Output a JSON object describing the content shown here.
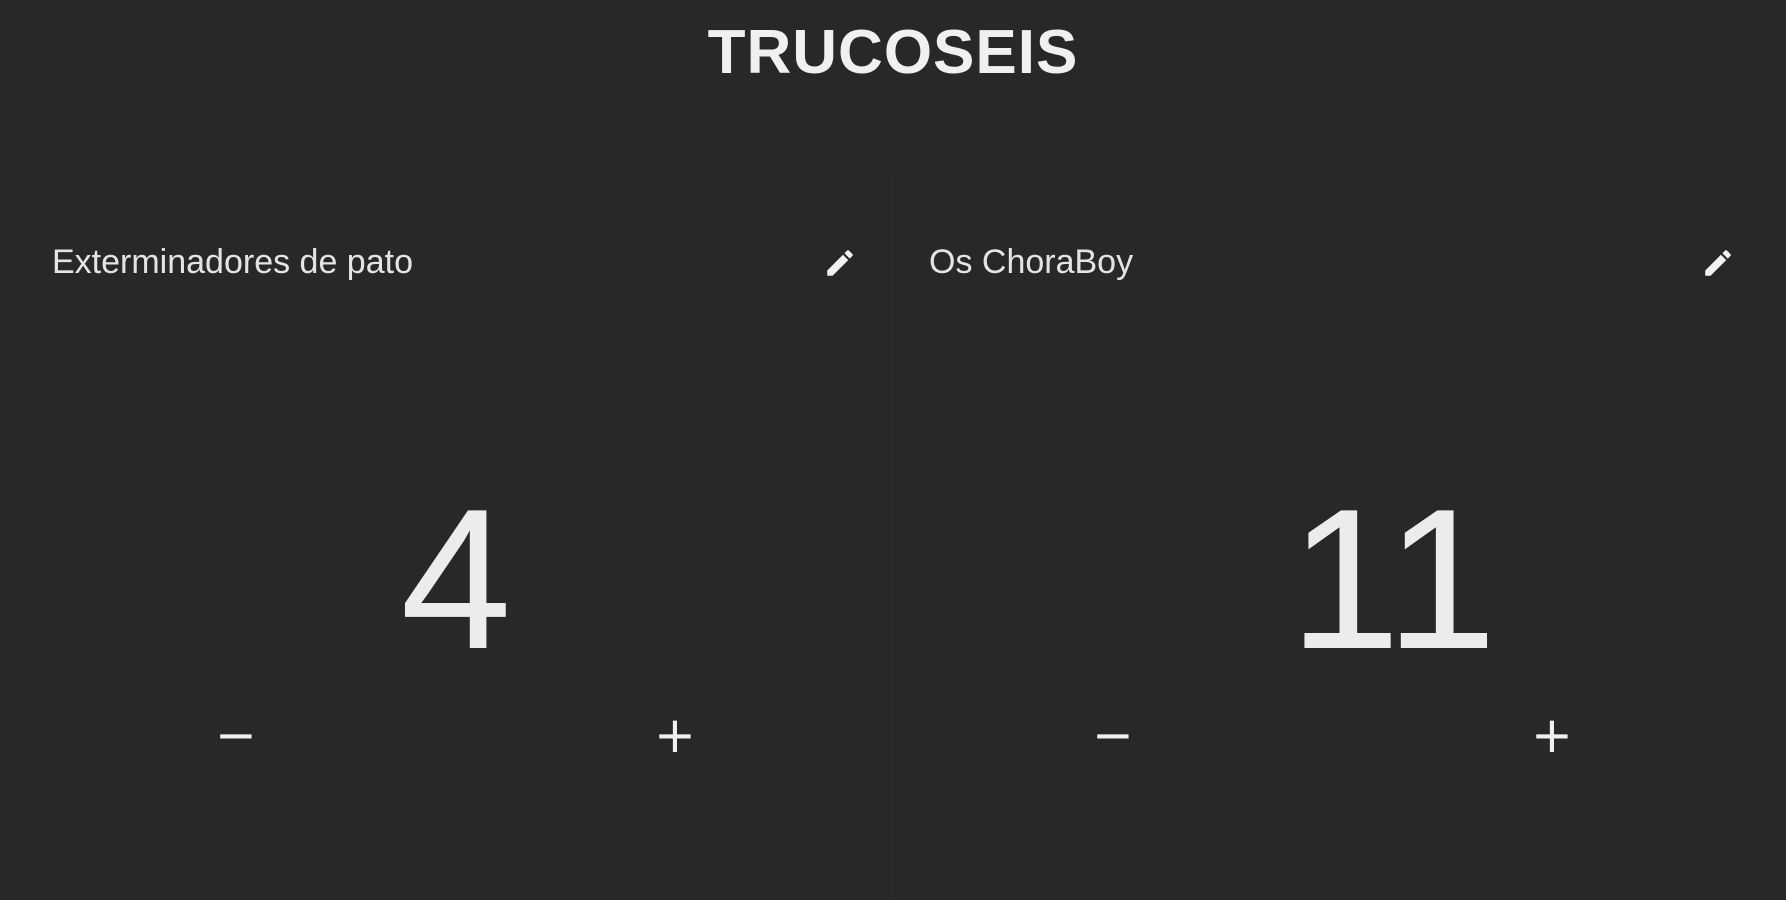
{
  "app": {
    "title": "TRUCOSEIS"
  },
  "teams": [
    {
      "name": "Exterminadores de pato",
      "score": "4",
      "minus_label": "−",
      "plus_label": "+",
      "edit_icon": "pencil-icon"
    },
    {
      "name": "Os ChoraBoy",
      "score": "11",
      "minus_label": "−",
      "plus_label": "+",
      "edit_icon": "pencil-icon"
    }
  ],
  "colors": {
    "background": "#282828",
    "text": "#ececec"
  }
}
